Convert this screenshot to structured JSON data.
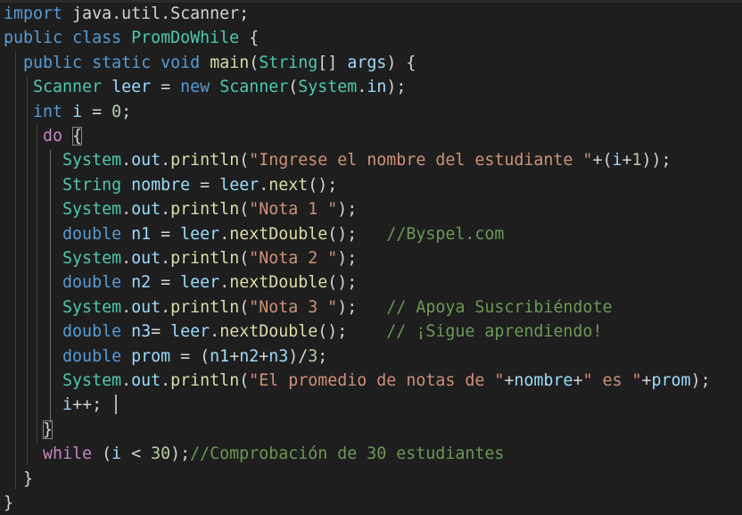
{
  "editor": {
    "language": "java",
    "lines": [
      [
        {
          "t": "import",
          "c": "kw"
        },
        {
          "t": " java.util.Scanner;",
          "c": "plain"
        }
      ],
      [
        {
          "t": "public",
          "c": "kw"
        },
        {
          "t": " ",
          "c": "plain"
        },
        {
          "t": "class",
          "c": "kw"
        },
        {
          "t": " ",
          "c": "plain"
        },
        {
          "t": "PromDoWhile",
          "c": "type"
        },
        {
          "t": " {",
          "c": "plain"
        }
      ],
      [
        {
          "t": "  ",
          "c": "plain"
        },
        {
          "t": "public",
          "c": "kw"
        },
        {
          "t": " ",
          "c": "plain"
        },
        {
          "t": "static",
          "c": "kw"
        },
        {
          "t": " ",
          "c": "plain"
        },
        {
          "t": "void",
          "c": "kw"
        },
        {
          "t": " ",
          "c": "plain"
        },
        {
          "t": "main",
          "c": "fn"
        },
        {
          "t": "(",
          "c": "plain"
        },
        {
          "t": "String",
          "c": "type"
        },
        {
          "t": "[] ",
          "c": "plain"
        },
        {
          "t": "args",
          "c": "var"
        },
        {
          "t": ") {",
          "c": "plain"
        }
      ],
      [
        {
          "t": "   ",
          "c": "plain"
        },
        {
          "t": "Scanner",
          "c": "type"
        },
        {
          "t": " ",
          "c": "plain"
        },
        {
          "t": "leer",
          "c": "var"
        },
        {
          "t": " = ",
          "c": "plain"
        },
        {
          "t": "new",
          "c": "kw"
        },
        {
          "t": " ",
          "c": "plain"
        },
        {
          "t": "Scanner",
          "c": "type"
        },
        {
          "t": "(",
          "c": "plain"
        },
        {
          "t": "System",
          "c": "type"
        },
        {
          "t": ".",
          "c": "plain"
        },
        {
          "t": "in",
          "c": "var"
        },
        {
          "t": ");",
          "c": "plain"
        }
      ],
      [
        {
          "t": "   ",
          "c": "plain"
        },
        {
          "t": "int",
          "c": "kw"
        },
        {
          "t": " ",
          "c": "plain"
        },
        {
          "t": "i",
          "c": "var"
        },
        {
          "t": " = ",
          "c": "plain"
        },
        {
          "t": "0",
          "c": "num"
        },
        {
          "t": ";",
          "c": "plain"
        }
      ],
      [
        {
          "t": "    ",
          "c": "plain"
        },
        {
          "t": "do",
          "c": "ctrl"
        },
        {
          "t": " ",
          "c": "plain"
        },
        {
          "t": "{",
          "c": "plain",
          "box": true
        }
      ],
      [
        {
          "t": "      ",
          "c": "plain"
        },
        {
          "t": "System",
          "c": "type"
        },
        {
          "t": ".",
          "c": "plain"
        },
        {
          "t": "out",
          "c": "var"
        },
        {
          "t": ".",
          "c": "plain"
        },
        {
          "t": "println",
          "c": "fn"
        },
        {
          "t": "(",
          "c": "plain"
        },
        {
          "t": "\"Ingrese el nombre del estudiante \"",
          "c": "str"
        },
        {
          "t": "+(",
          "c": "plain"
        },
        {
          "t": "i",
          "c": "var"
        },
        {
          "t": "+",
          "c": "plain"
        },
        {
          "t": "1",
          "c": "num"
        },
        {
          "t": "));",
          "c": "plain"
        }
      ],
      [
        {
          "t": "      ",
          "c": "plain"
        },
        {
          "t": "String",
          "c": "type"
        },
        {
          "t": " ",
          "c": "plain"
        },
        {
          "t": "nombre",
          "c": "var"
        },
        {
          "t": " = ",
          "c": "plain"
        },
        {
          "t": "leer",
          "c": "var"
        },
        {
          "t": ".",
          "c": "plain"
        },
        {
          "t": "next",
          "c": "fn"
        },
        {
          "t": "();",
          "c": "plain"
        }
      ],
      [
        {
          "t": "      ",
          "c": "plain"
        },
        {
          "t": "System",
          "c": "type"
        },
        {
          "t": ".",
          "c": "plain"
        },
        {
          "t": "out",
          "c": "var"
        },
        {
          "t": ".",
          "c": "plain"
        },
        {
          "t": "println",
          "c": "fn"
        },
        {
          "t": "(",
          "c": "plain"
        },
        {
          "t": "\"Nota 1 \"",
          "c": "str"
        },
        {
          "t": ");",
          "c": "plain"
        }
      ],
      [
        {
          "t": "      ",
          "c": "plain"
        },
        {
          "t": "double",
          "c": "kw"
        },
        {
          "t": " ",
          "c": "plain"
        },
        {
          "t": "n1",
          "c": "var"
        },
        {
          "t": " = ",
          "c": "plain"
        },
        {
          "t": "leer",
          "c": "var"
        },
        {
          "t": ".",
          "c": "plain"
        },
        {
          "t": "nextDouble",
          "c": "fn"
        },
        {
          "t": "();   ",
          "c": "plain"
        },
        {
          "t": "//Byspel.com",
          "c": "cmt"
        }
      ],
      [
        {
          "t": "      ",
          "c": "plain"
        },
        {
          "t": "System",
          "c": "type"
        },
        {
          "t": ".",
          "c": "plain"
        },
        {
          "t": "out",
          "c": "var"
        },
        {
          "t": ".",
          "c": "plain"
        },
        {
          "t": "println",
          "c": "fn"
        },
        {
          "t": "(",
          "c": "plain"
        },
        {
          "t": "\"Nota 2 \"",
          "c": "str"
        },
        {
          "t": ");",
          "c": "plain"
        }
      ],
      [
        {
          "t": "      ",
          "c": "plain"
        },
        {
          "t": "double",
          "c": "kw"
        },
        {
          "t": " ",
          "c": "plain"
        },
        {
          "t": "n2",
          "c": "var"
        },
        {
          "t": " = ",
          "c": "plain"
        },
        {
          "t": "leer",
          "c": "var"
        },
        {
          "t": ".",
          "c": "plain"
        },
        {
          "t": "nextDouble",
          "c": "fn"
        },
        {
          "t": "();",
          "c": "plain"
        }
      ],
      [
        {
          "t": "      ",
          "c": "plain"
        },
        {
          "t": "System",
          "c": "type"
        },
        {
          "t": ".",
          "c": "plain"
        },
        {
          "t": "out",
          "c": "var"
        },
        {
          "t": ".",
          "c": "plain"
        },
        {
          "t": "println",
          "c": "fn"
        },
        {
          "t": "(",
          "c": "plain"
        },
        {
          "t": "\"Nota 3 \"",
          "c": "str"
        },
        {
          "t": ");   ",
          "c": "plain"
        },
        {
          "t": "// Apoya Suscribiéndote",
          "c": "cmt"
        }
      ],
      [
        {
          "t": "      ",
          "c": "plain"
        },
        {
          "t": "double",
          "c": "kw"
        },
        {
          "t": " ",
          "c": "plain"
        },
        {
          "t": "n3",
          "c": "var"
        },
        {
          "t": "= ",
          "c": "plain"
        },
        {
          "t": "leer",
          "c": "var"
        },
        {
          "t": ".",
          "c": "plain"
        },
        {
          "t": "nextDouble",
          "c": "fn"
        },
        {
          "t": "();    ",
          "c": "plain"
        },
        {
          "t": "// ¡Sigue aprendiendo!",
          "c": "cmt"
        }
      ],
      [
        {
          "t": "      ",
          "c": "plain"
        },
        {
          "t": "double",
          "c": "kw"
        },
        {
          "t": " ",
          "c": "plain"
        },
        {
          "t": "prom",
          "c": "var"
        },
        {
          "t": " = (",
          "c": "plain"
        },
        {
          "t": "n1",
          "c": "var"
        },
        {
          "t": "+",
          "c": "plain"
        },
        {
          "t": "n2",
          "c": "var"
        },
        {
          "t": "+",
          "c": "plain"
        },
        {
          "t": "n3",
          "c": "var"
        },
        {
          "t": ")/",
          "c": "plain"
        },
        {
          "t": "3",
          "c": "num"
        },
        {
          "t": ";",
          "c": "plain"
        }
      ],
      [
        {
          "t": "      ",
          "c": "plain"
        },
        {
          "t": "System",
          "c": "type"
        },
        {
          "t": ".",
          "c": "plain"
        },
        {
          "t": "out",
          "c": "var"
        },
        {
          "t": ".",
          "c": "plain"
        },
        {
          "t": "println",
          "c": "fn"
        },
        {
          "t": "(",
          "c": "plain"
        },
        {
          "t": "\"El promedio de notas de \"",
          "c": "str"
        },
        {
          "t": "+",
          "c": "plain"
        },
        {
          "t": "nombre",
          "c": "var"
        },
        {
          "t": "+",
          "c": "plain"
        },
        {
          "t": "\" es \"",
          "c": "str"
        },
        {
          "t": "+",
          "c": "plain"
        },
        {
          "t": "prom",
          "c": "var"
        },
        {
          "t": ");",
          "c": "plain"
        }
      ],
      [
        {
          "t": "      ",
          "c": "plain"
        },
        {
          "t": "i",
          "c": "var"
        },
        {
          "t": "++;",
          "c": "plain"
        }
      ],
      [
        {
          "t": "    ",
          "c": "plain"
        },
        {
          "t": "}",
          "c": "plain",
          "box": true
        }
      ],
      [
        {
          "t": "    ",
          "c": "plain"
        },
        {
          "t": "while",
          "c": "ctrl"
        },
        {
          "t": " (",
          "c": "plain"
        },
        {
          "t": "i",
          "c": "var"
        },
        {
          "t": " < ",
          "c": "plain"
        },
        {
          "t": "30",
          "c": "num"
        },
        {
          "t": ");",
          "c": "plain"
        },
        {
          "t": "//Comprobación de 30 estudiantes",
          "c": "cmt"
        }
      ],
      [
        {
          "t": "  }",
          "c": "plain"
        }
      ],
      [
        {
          "t": "}",
          "c": "plain"
        }
      ]
    ]
  }
}
